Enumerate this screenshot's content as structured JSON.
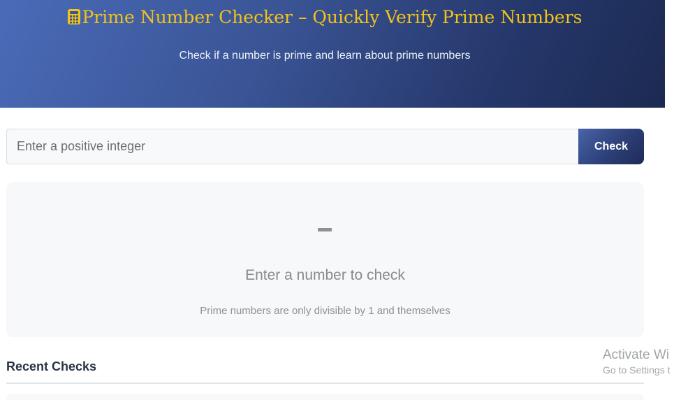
{
  "header": {
    "title": "Prime Number Checker – Quickly Verify Prime Numbers",
    "title_icon": "calculator-icon",
    "subtitle": "Check if a number is prime and learn about prime numbers",
    "colors": {
      "gradient_start": "#4a6bb8",
      "gradient_end": "#1c2a52",
      "title": "#f2c318"
    }
  },
  "search": {
    "value": "",
    "placeholder": "Enter a positive integer",
    "button_label": "Check"
  },
  "result": {
    "icon": "dash-icon",
    "title": "Enter a number to check",
    "hint": "Prime numbers are only divisible by 1 and themselves"
  },
  "recent": {
    "title": "Recent Checks"
  },
  "watermark": {
    "title": "Activate Wi",
    "subtitle": "Go to Settings t"
  }
}
